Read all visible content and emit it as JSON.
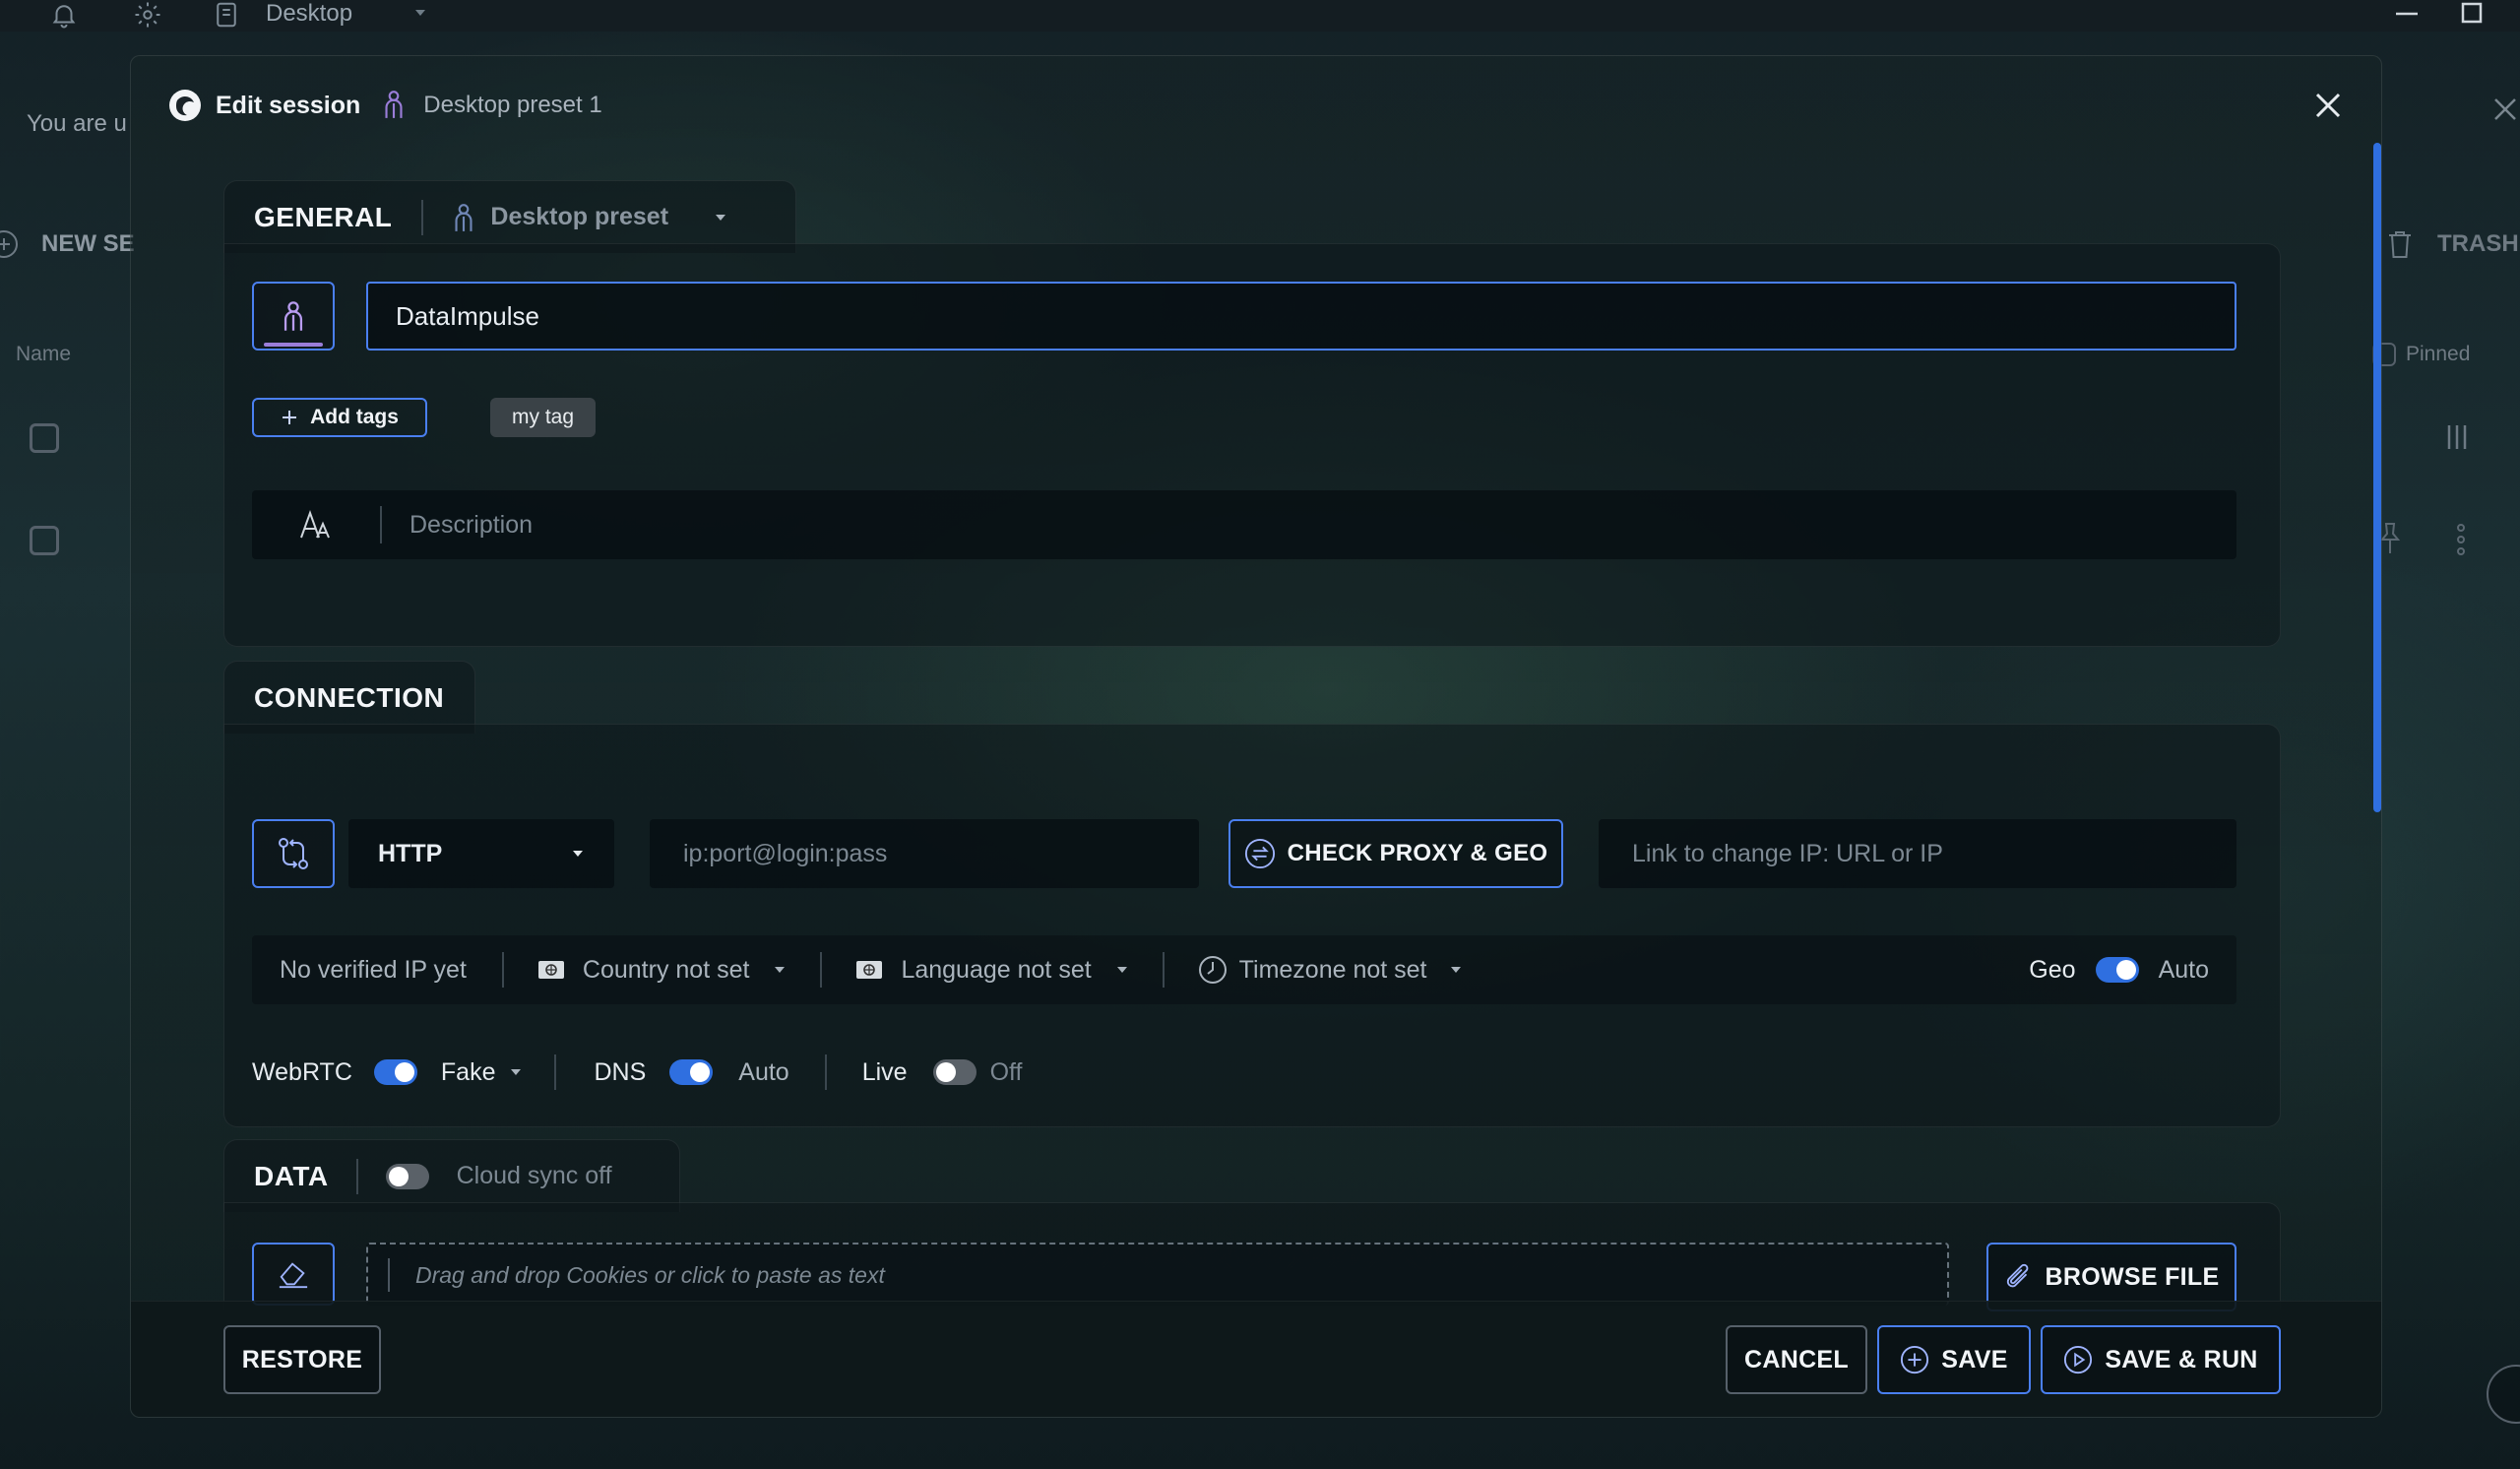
{
  "window": {
    "app_menu_label": "Desktop"
  },
  "background": {
    "banner_text": "You are u",
    "new_session_label": "NEW SE",
    "trash_label": "TRASH",
    "column_name": "Name",
    "column_pinned": "Pinned"
  },
  "modal": {
    "title": "Edit session",
    "preset_name": "Desktop preset 1",
    "general": {
      "heading": "GENERAL",
      "preset_selector": "Desktop preset",
      "session_name": "DataImpulse",
      "add_tags_label": "Add tags",
      "tags": [
        "my tag"
      ],
      "description_placeholder": "Description"
    },
    "connection": {
      "heading": "CONNECTION",
      "proxy_type": "HTTP",
      "proxy_placeholder": "ip:port@login:pass",
      "check_button": "CHECK PROXY & GEO",
      "change_ip_placeholder": "Link to change IP: URL or IP",
      "verified_ip": "No verified IP yet",
      "country": "Country not set",
      "language": "Language not set",
      "timezone": "Timezone not set",
      "geo_label": "Geo",
      "geo_value": "Auto",
      "geo_on": true,
      "webrtc_label": "WebRTC",
      "webrtc_value": "Fake",
      "webrtc_on": true,
      "dns_label": "DNS",
      "dns_value": "Auto",
      "dns_on": true,
      "live_label": "Live",
      "live_value": "Off",
      "live_on": false
    },
    "data": {
      "heading": "DATA",
      "cloud_sync_label": "Cloud sync off",
      "cloud_sync_on": false,
      "cookies_placeholder": "Drag and drop Cookies or click to paste as text",
      "browse_button": "BROWSE FILE"
    },
    "footer": {
      "restore": "RESTORE",
      "cancel": "CANCEL",
      "save": "SAVE",
      "save_run": "SAVE & RUN"
    }
  },
  "colors": {
    "accent": "#2f6fe0",
    "accent_border": "#4a7ff0",
    "preset_icon": "#9a7dd8"
  }
}
